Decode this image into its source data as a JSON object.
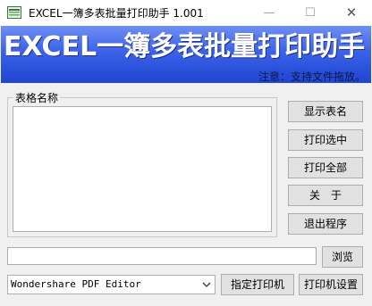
{
  "window": {
    "title": "EXCEL一簿多表批量打印助手  1.001",
    "minimize_glyph": "—",
    "maximize_glyph": "☐",
    "close_glyph": "✕"
  },
  "banner": {
    "title": "EXCEL一簿多表批量打印助手",
    "note": "注意：支持文件拖放。"
  },
  "sheet_list": {
    "label": "表格名称",
    "items": []
  },
  "side_buttons": {
    "show_sheets": "显示表名",
    "print_selected": "打印选中",
    "print_all": "打印全部",
    "about": "关　于",
    "exit": "退出程序"
  },
  "file": {
    "path_value": "",
    "browse_label": "浏览"
  },
  "printer": {
    "selected": "Wondershare PDF Editor",
    "set_printer_label": "指定打印机",
    "printer_settings_label": "打印机设置"
  },
  "colors": {
    "banner_top": "#6f8ff5",
    "banner_bottom": "#1f45d2",
    "banner_text": "#ffffff",
    "button_face": "#e1e1e1"
  },
  "icons": {
    "app": "excel-app-icon",
    "dropdown": "chevron-down-icon"
  }
}
